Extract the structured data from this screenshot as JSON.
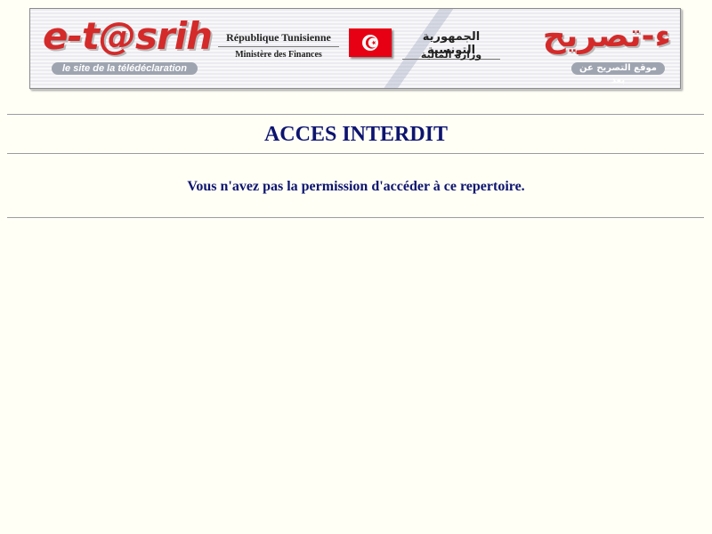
{
  "banner": {
    "logo_fr": "e-t@srih",
    "tagline_fr": "le site de la télédéclaration",
    "republic_fr": "République Tunisienne",
    "ministry_fr": "Ministère des Finances",
    "republic_ar": "الجمهورية التونسية",
    "ministry_ar": "وزارة المالية",
    "logo_ar": "ء-تصريح",
    "tagline_ar": "موقع التصريح عن بعد",
    "flag_icon": "tunisia-flag-icon"
  },
  "colors": {
    "page_background": "#fffff5",
    "logo_red": "#d42a2a",
    "heading_navy": "#0d1470",
    "flag_red": "#e70013"
  },
  "error": {
    "title": "ACCES INTERDIT",
    "message": "Vous n'avez pas la permission d'accéder à ce repertoire."
  }
}
